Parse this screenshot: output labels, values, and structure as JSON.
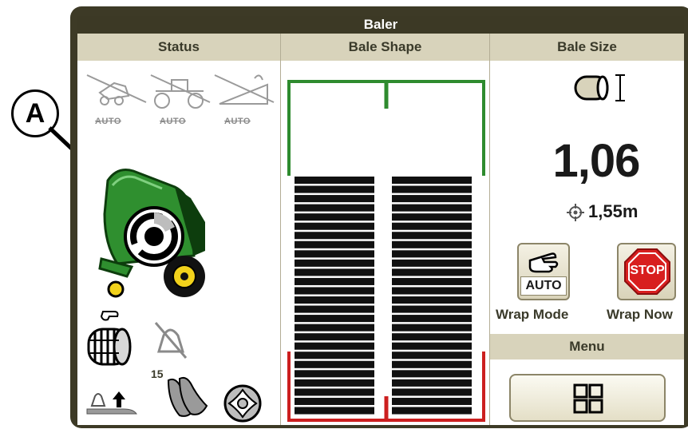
{
  "callout": {
    "label": "A"
  },
  "screen": {
    "title": "Baler",
    "columns": {
      "status": "Status",
      "bale_shape": "Bale Shape",
      "bale_size": "Bale Size"
    }
  },
  "status": {
    "auto_labels": [
      "AUTO",
      "AUTO",
      "AUTO"
    ],
    "knife_count": "15",
    "icons": [
      "tractor-baler-auto-disabled-icon",
      "tractor-auto-disabled-icon",
      "ramp-auto-disabled-icon",
      "baler-wrap-status-icon",
      "net-wrap-roll-icon",
      "tailgate-disabled-icon",
      "tailgate-lift-icon",
      "knives-icon",
      "pickup-icon"
    ]
  },
  "bale_shape": {
    "left_fill": 1.0,
    "right_fill": 1.0,
    "colors": {
      "outline_top": "#2e8b2e",
      "outline_bottom": "#cc1f1f",
      "bar": "#111111"
    }
  },
  "bale_size": {
    "value": "1,06",
    "diameter": "1,55m"
  },
  "wrap": {
    "mode_label": "Wrap Mode",
    "mode_value": "AUTO",
    "now_label": "Wrap Now",
    "stop_text": "STOP"
  },
  "menu": {
    "label": "Menu"
  },
  "colors": {
    "header_bg": "#3c3925",
    "column_head_bg": "#d8d3bb",
    "baler_green": "#2f8f2f",
    "baler_yellow": "#f2d21b"
  }
}
